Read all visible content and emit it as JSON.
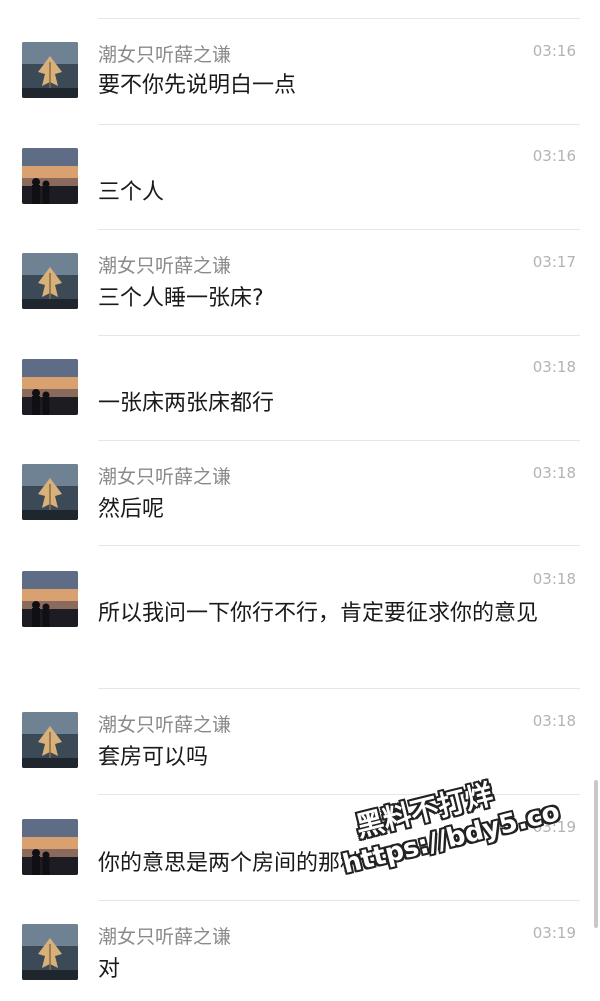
{
  "chat": {
    "messages": [
      {
        "sender": "潮女只听薛之谦",
        "time": "03:16",
        "text": "要不你先说明白一点",
        "avatar": "leaf-avatar"
      },
      {
        "sender": "",
        "time": "03:16",
        "text": "三个人",
        "avatar": "sunset-avatar"
      },
      {
        "sender": "潮女只听薛之谦",
        "time": "03:17",
        "text": "三个人睡一张床?",
        "avatar": "leaf-avatar"
      },
      {
        "sender": "",
        "time": "03:18",
        "text": "一张床两张床都行",
        "avatar": "sunset-avatar"
      },
      {
        "sender": "潮女只听薛之谦",
        "time": "03:18",
        "text": "然后呢",
        "avatar": "leaf-avatar"
      },
      {
        "sender": "",
        "time": "03:18",
        "text": "所以我问一下你行不行，肯定要征求你的意见",
        "avatar": "sunset-avatar"
      },
      {
        "sender": "潮女只听薛之谦",
        "time": "03:18",
        "text": "套房可以吗",
        "avatar": "leaf-avatar"
      },
      {
        "sender": "",
        "time": "03:19",
        "text": "你的意思是两个房间的那种",
        "avatar": "sunset-avatar"
      },
      {
        "sender": "潮女只听薛之谦",
        "time": "03:19",
        "text": "对",
        "avatar": "leaf-avatar"
      }
    ]
  },
  "watermark": {
    "line1": "黑料不打烊",
    "line2": "https://bdy5.co"
  }
}
